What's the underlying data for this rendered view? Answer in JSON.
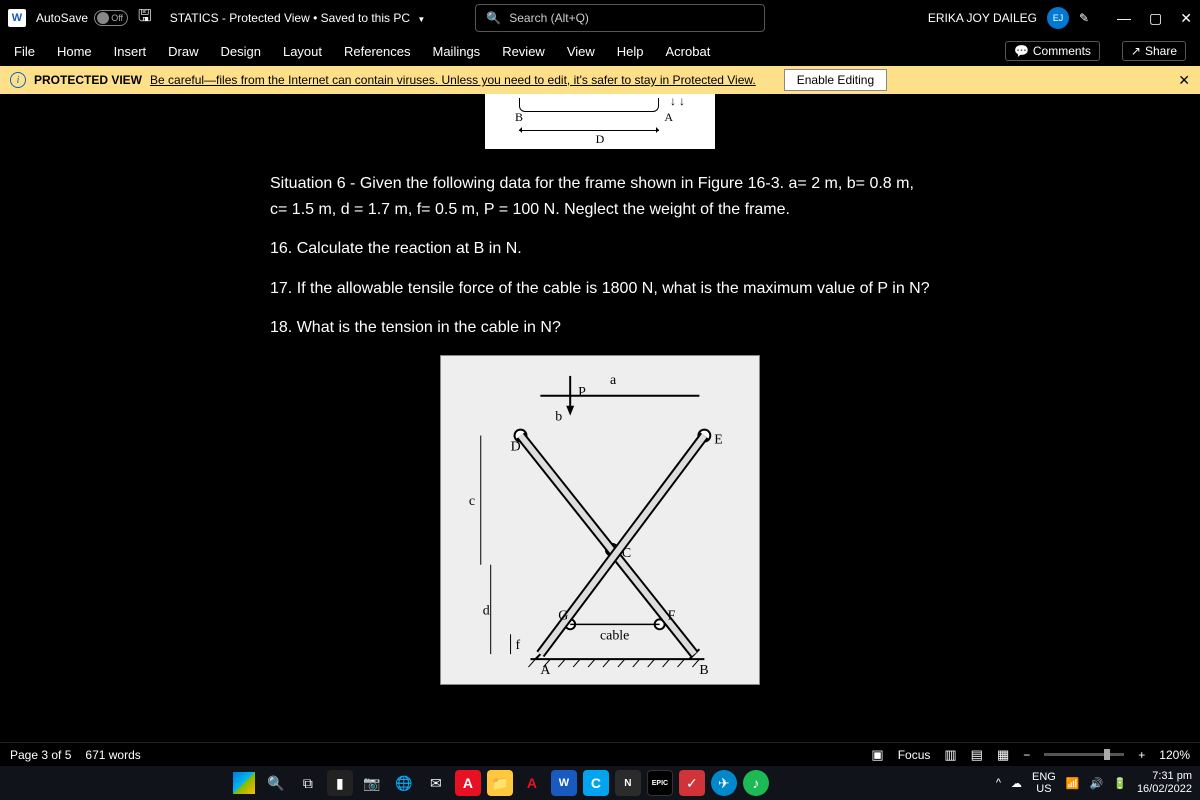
{
  "titlebar": {
    "autosave_label": "AutoSave",
    "autosave_state": "Off",
    "doc_name": "STATICS",
    "doc_status": "Protected View • Saved to this PC",
    "search_placeholder": "Search (Alt+Q)",
    "user_name": "ERIKA JOY DAILEG",
    "user_initials": "EJ"
  },
  "ribbon": {
    "tabs": [
      "File",
      "Home",
      "Insert",
      "Draw",
      "Design",
      "Layout",
      "References",
      "Mailings",
      "Review",
      "View",
      "Help",
      "Acrobat"
    ],
    "comments": "Comments",
    "share": "Share"
  },
  "protected_view": {
    "label": "PROTECTED VIEW",
    "message_plain": "Be careful—files from the Internet can contain viruses. Unless you need to edit, it's safer to stay in Protected View.",
    "enable": "Enable Editing"
  },
  "document": {
    "situation": "Situation 6 - Given the following data for the frame shown in Figure 16-3. a= 2 m, b= 0.8 m, c= 1.5 m, d = 1.7 m, f= 0.5 m, P = 100 N. Neglect the weight of the frame.",
    "q16": "16. Calculate the reaction at B in N.",
    "q17": "17. If the allowable tensile force of the cable is 1800 N, what is the maximum value of P in N?",
    "q18": "18. What is the tension in the cable in N?",
    "fig_labels": {
      "a": "a",
      "b": "b",
      "c": "c",
      "d": "d",
      "f": "f",
      "P": "P",
      "A": "A",
      "B": "B",
      "C": "C",
      "D": "D",
      "E": "E",
      "F": "F",
      "G": "G",
      "cable": "cable"
    },
    "top_fig": {
      "B": "B",
      "A": "A",
      "D": "D"
    }
  },
  "statusbar": {
    "page": "Page 3 of 5",
    "words": "671 words",
    "focus": "Focus",
    "zoom": "120%"
  },
  "taskbar": {
    "lang1": "ENG",
    "lang2": "US",
    "time": "7:31 pm",
    "date": "16/02/2022"
  }
}
